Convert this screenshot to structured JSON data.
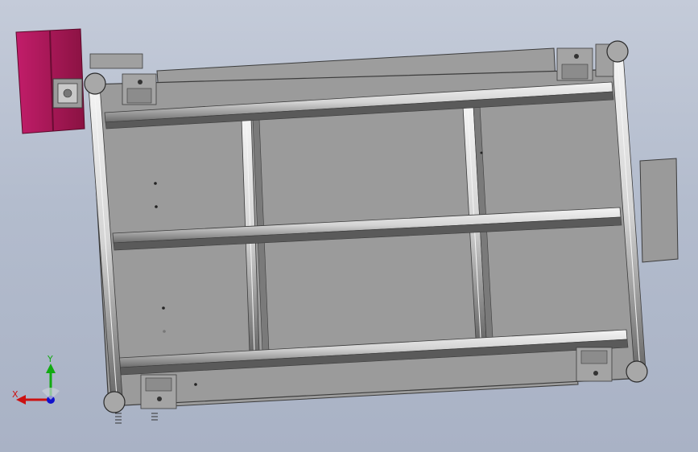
{
  "viewport": {
    "background_top": "#c4cbd9",
    "background_bottom": "#a9b2c5"
  },
  "model": {
    "components": [
      "conveyor-frame",
      "drive-motor",
      "end-rollers",
      "cross-members",
      "support-brackets",
      "side-rails",
      "side-panel",
      "springs"
    ],
    "colors": {
      "frame": "#999999",
      "frame_dark": "#4a4a4a",
      "rail_highlight": "#f2f2f2",
      "motor": "#b01a5a",
      "motor_dark": "#7d0f3d",
      "roller": "#a8a8a8"
    }
  },
  "triad": {
    "x_label": "X",
    "y_label": "Y",
    "x_color": "#cc1111",
    "y_color": "#11aa11",
    "z_color": "#1111cc"
  }
}
